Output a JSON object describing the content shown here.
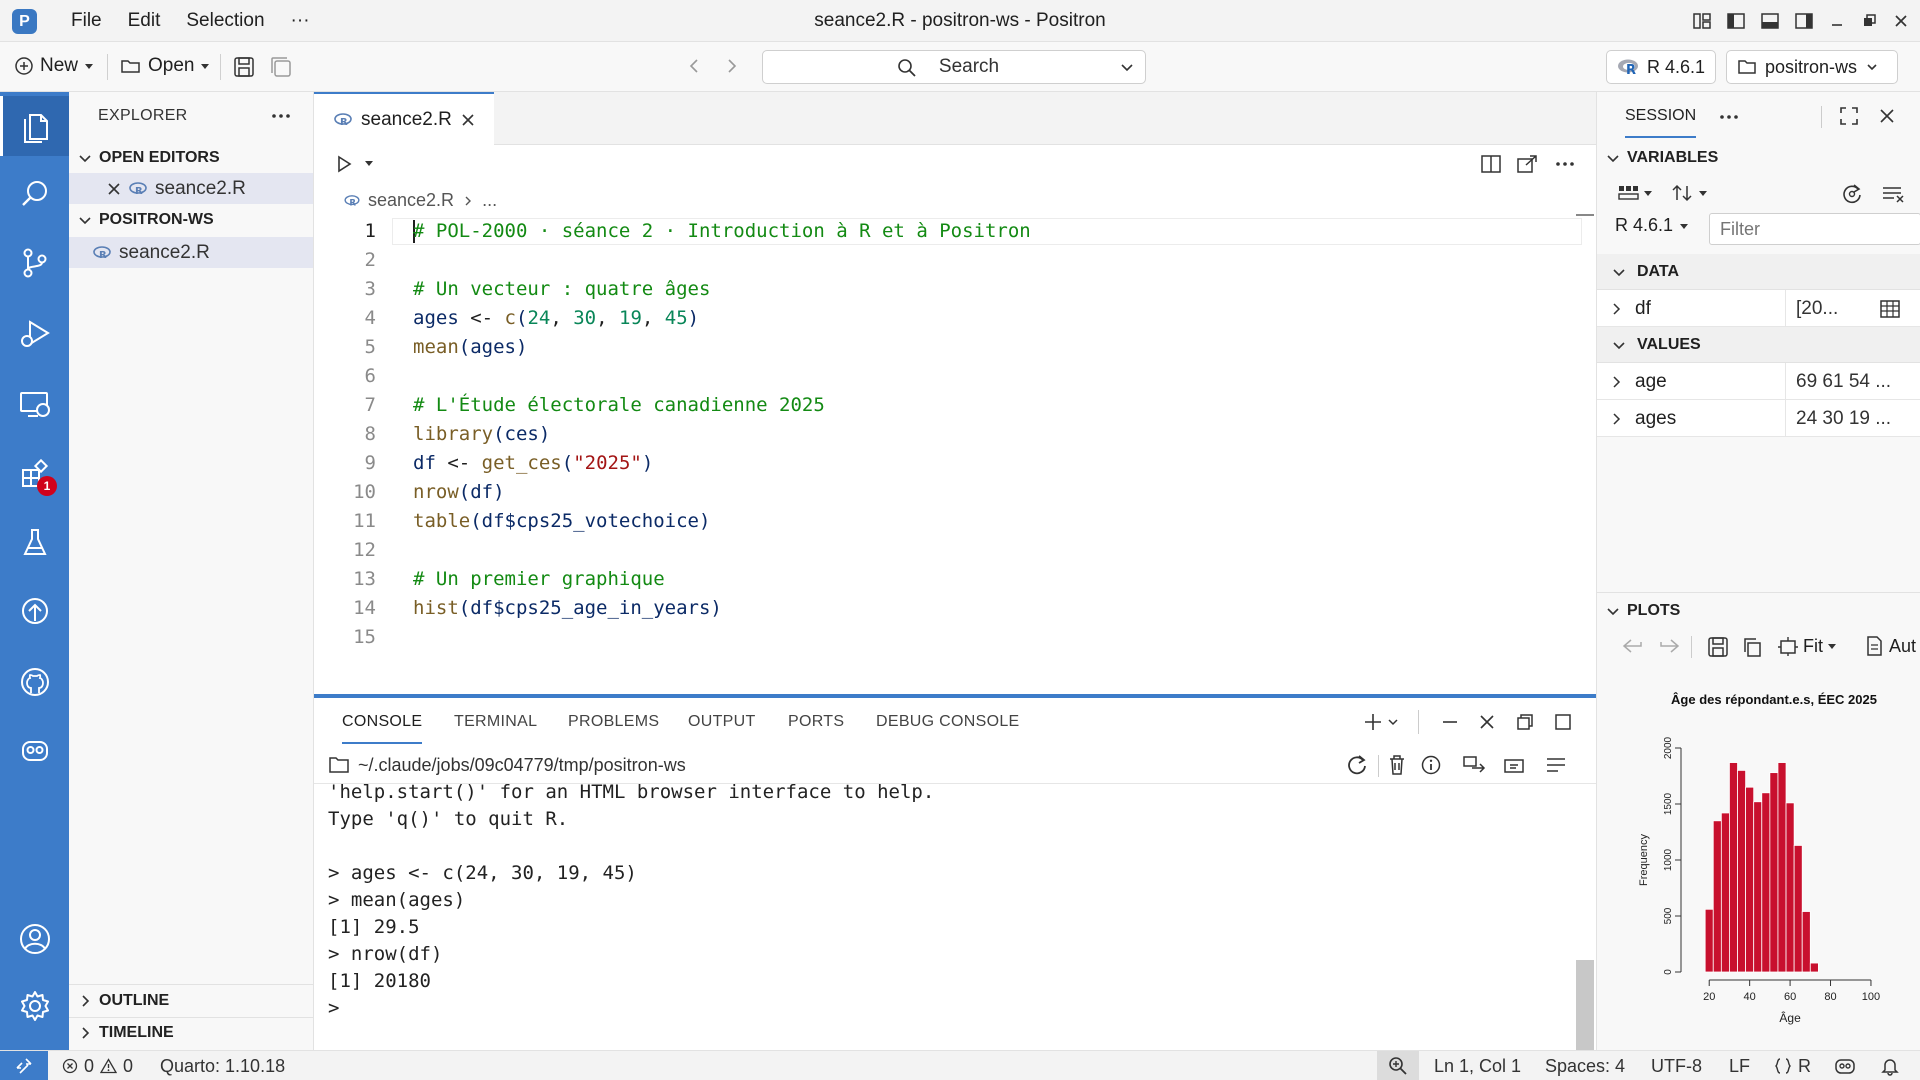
{
  "window": {
    "title": "seance2.R - positron-ws - Positron",
    "menu": [
      "File",
      "Edit",
      "Selection",
      "···"
    ]
  },
  "toolbar": {
    "new_label": "New",
    "open_label": "Open",
    "search_label": "Search",
    "r_version": "R 4.6.1",
    "workspace": "positron-ws"
  },
  "activity": {
    "extensions_badge": "1"
  },
  "explorer": {
    "title": "EXPLORER",
    "open_editors_label": "OPEN EDITORS",
    "open_editor_file": "seance2.R",
    "workspace_label": "POSITRON-WS",
    "workspace_file": "seance2.R",
    "outline_label": "OUTLINE",
    "timeline_label": "TIMELINE"
  },
  "editor": {
    "tab_label": "seance2.R",
    "breadcrumb_file": "seance2.R",
    "breadcrumb_rest": "...",
    "line_numbers": [
      "1",
      "2",
      "3",
      "4",
      "5",
      "6",
      "7",
      "8",
      "9",
      "10",
      "11",
      "12",
      "13",
      "14",
      "15"
    ],
    "lines": {
      "l1": "# POL-2000 · séance 2 · Introduction à R et à Positron",
      "l3": "# Un vecteur : quatre âges",
      "l4_a": "ages",
      "l4_b": " <- ",
      "l4_c": "c",
      "l4_d": "(",
      "l4_n1": "24",
      "l4_s1": ", ",
      "l4_n2": "30",
      "l4_s2": ", ",
      "l4_n3": "19",
      "l4_s3": ", ",
      "l4_n4": "45",
      "l4_e": ")",
      "l5_fn": "mean",
      "l5_rest": "(ages)",
      "l7": "# L'Étude électorale canadienne 2025",
      "l8_fn": "library",
      "l8_rest": "(ces)",
      "l9_a": "df",
      "l9_b": " <- ",
      "l9_fn": "get_ces",
      "l9_p1": "(",
      "l9_str": "\"2025\"",
      "l9_p2": ")",
      "l10_fn": "nrow",
      "l10_rest": "(df)",
      "l11_fn": "table",
      "l11_rest": "(df$cps25_votechoice)",
      "l13": "# Un premier graphique",
      "l14_fn": "hist",
      "l14_rest": "(df$cps25_age_in_years)"
    }
  },
  "panel": {
    "tabs": [
      "CONSOLE",
      "TERMINAL",
      "PROBLEMS",
      "OUTPUT",
      "PORTS",
      "DEBUG CONSOLE"
    ],
    "cwd": "~/.claude/jobs/09c04779/tmp/positron-ws",
    "console_lines": [
      "'help.start()' for an HTML browser interface to help.",
      "Type 'q()' to quit R.",
      "",
      "> ages <- c(24, 30, 19, 45)",
      "> mean(ages)",
      "[1] 29.5",
      "> nrow(df)",
      "[1] 20180",
      ">"
    ]
  },
  "session": {
    "title": "SESSION",
    "variables_label": "VARIABLES",
    "r_selector": "R 4.6.1",
    "filter_placeholder": "Filter",
    "data_label": "DATA",
    "values_label": "VALUES",
    "data_rows": [
      {
        "name": "df",
        "value": "[20..."
      }
    ],
    "value_rows": [
      {
        "name": "age",
        "value": "69 61 54 ..."
      },
      {
        "name": "ages",
        "value": "24 30 19 ..."
      }
    ],
    "plots_label": "PLOTS",
    "fit_label": "Fit",
    "auto_label": "Aut"
  },
  "plot": {
    "title": "Âge des répondant.e.s, ÉEC 2025",
    "xlabel": "Âge",
    "ylabel": "Frequency",
    "xticks": [
      "20",
      "40",
      "60",
      "80",
      "100"
    ],
    "yticks": [
      "0",
      "500",
      "1000",
      "1500",
      "2000"
    ],
    "bar_color": "#c8102e",
    "bin_start": 18,
    "bin_width": 4,
    "ymax": 2000,
    "counts": [
      560,
      1350,
      1420,
      1870,
      1800,
      1650,
      1520,
      1600,
      1780,
      1870,
      1510,
      1130,
      540,
      80
    ]
  },
  "statusbar": {
    "errors": "0",
    "warnings": "0",
    "quarto": "Quarto: 1.10.18",
    "position": "Ln 1, Col 1",
    "spaces": "Spaces: 4",
    "encoding": "UTF-8",
    "eol": "LF",
    "language": "R"
  }
}
